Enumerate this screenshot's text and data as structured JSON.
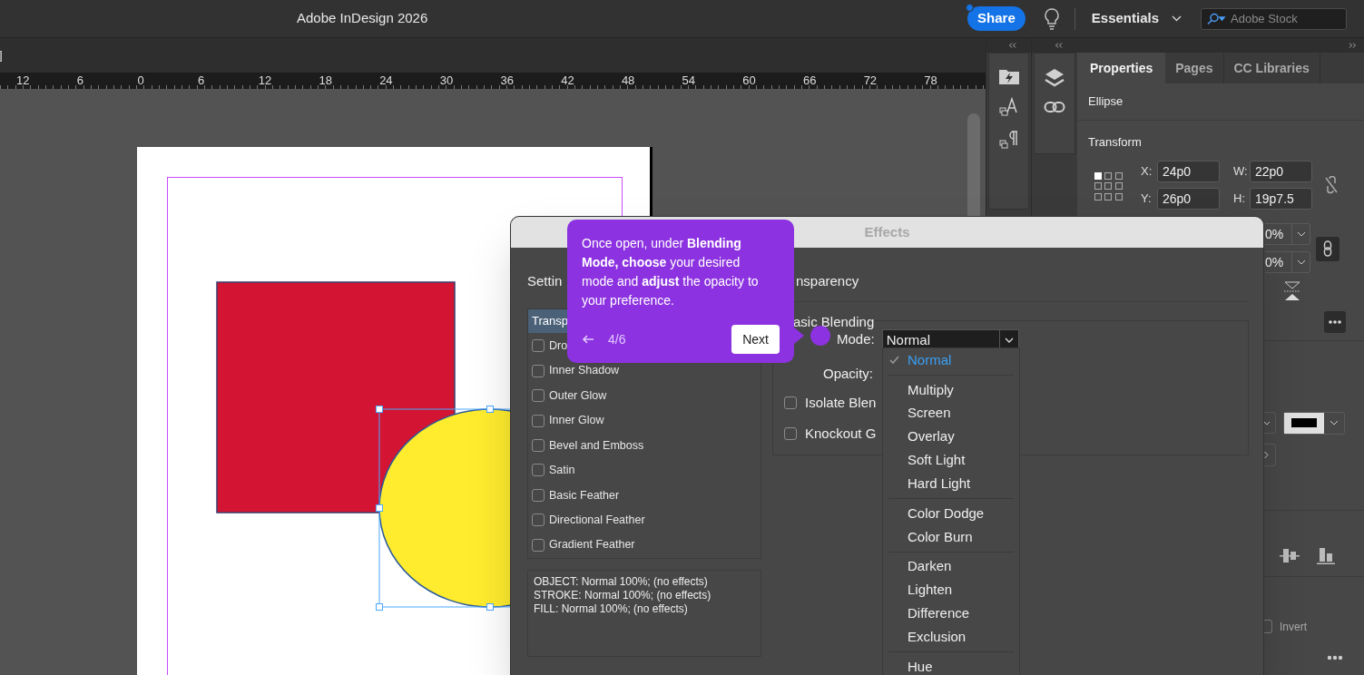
{
  "window": {
    "title": "Adobe InDesign 2026"
  },
  "top_bar": {
    "share": "Share",
    "workspace": "Essentials",
    "search": {
      "placeholder": "Adobe Stock"
    }
  },
  "document": {
    "edge_mark": "]",
    "ruler": [
      "12",
      "6",
      "0",
      "6",
      "12",
      "18",
      "24",
      "30",
      "36",
      "42",
      "48",
      "54",
      "60",
      "66",
      "72",
      "78"
    ]
  },
  "panel_tabs": [
    {
      "label": "Properties",
      "selected": true
    },
    {
      "label": "Pages",
      "selected": false
    },
    {
      "label": "CC Libraries",
      "selected": false
    }
  ],
  "properties": {
    "object": "Ellipse",
    "section": "Transform",
    "fields": [
      {
        "label": "X:",
        "value": "24p0"
      },
      {
        "label": "W:",
        "value": "22p0"
      },
      {
        "label": "Y:",
        "value": "26p0"
      },
      {
        "label": "H:",
        "value": "19p7.5"
      }
    ],
    "scale_fields": [
      "0%",
      "0%"
    ],
    "invert": {
      "label": "Invert",
      "checked": false
    }
  },
  "effects_dialog": {
    "title": "Effects",
    "settings_label": "Settin",
    "effects": [
      {
        "label": "Transp",
        "kind": "header",
        "selected": true
      },
      {
        "label": "Dro",
        "kind": "checkbox",
        "checked": false
      },
      {
        "label": "Inner Shadow",
        "kind": "checkbox",
        "checked": false
      },
      {
        "label": "Outer Glow",
        "kind": "checkbox",
        "checked": false
      },
      {
        "label": "Inner Glow",
        "kind": "checkbox",
        "checked": false
      },
      {
        "label": "Bevel and Emboss",
        "kind": "checkbox",
        "checked": false
      },
      {
        "label": "Satin",
        "kind": "checkbox",
        "checked": false
      },
      {
        "label": "Basic Feather",
        "kind": "checkbox",
        "checked": false
      },
      {
        "label": "Directional Feather",
        "kind": "checkbox",
        "checked": false
      },
      {
        "label": "Gradient Feather",
        "kind": "checkbox",
        "checked": false
      }
    ],
    "summary": [
      "OBJECT: Normal 100%; (no effects)",
      "STROKE: Normal 100%; (no effects)",
      "FILL: Normal 100%; (no effects)"
    ],
    "section": "nsparency",
    "group": "asic Blending",
    "mode": {
      "label": "Mode:",
      "value": "Normal"
    },
    "opacity_label": "Opacity:",
    "options": [
      {
        "label": "Isolate Blen",
        "checked": false
      },
      {
        "label": "Knockout G",
        "checked": false
      }
    ]
  },
  "blend_menu": [
    [
      {
        "label": "Normal",
        "selected": true
      }
    ],
    [
      {
        "label": "Multiply",
        "selected": false
      },
      {
        "label": "Screen",
        "selected": false
      },
      {
        "label": "Overlay",
        "selected": false
      },
      {
        "label": "Soft Light",
        "selected": false
      },
      {
        "label": "Hard Light",
        "selected": false
      }
    ],
    [
      {
        "label": "Color Dodge",
        "selected": false
      },
      {
        "label": "Color Burn",
        "selected": false
      }
    ],
    [
      {
        "label": "Darken",
        "selected": false
      },
      {
        "label": "Lighten",
        "selected": false
      },
      {
        "label": "Difference",
        "selected": false
      },
      {
        "label": "Exclusion",
        "selected": false
      }
    ],
    [
      {
        "label": "Hue",
        "selected": false
      }
    ]
  ],
  "tour_tip": {
    "text": "Once open, under **Blending Mode, choose** your desired mode and **adjust** the opacity to your preference.",
    "step": "4/6",
    "next": "Next"
  }
}
